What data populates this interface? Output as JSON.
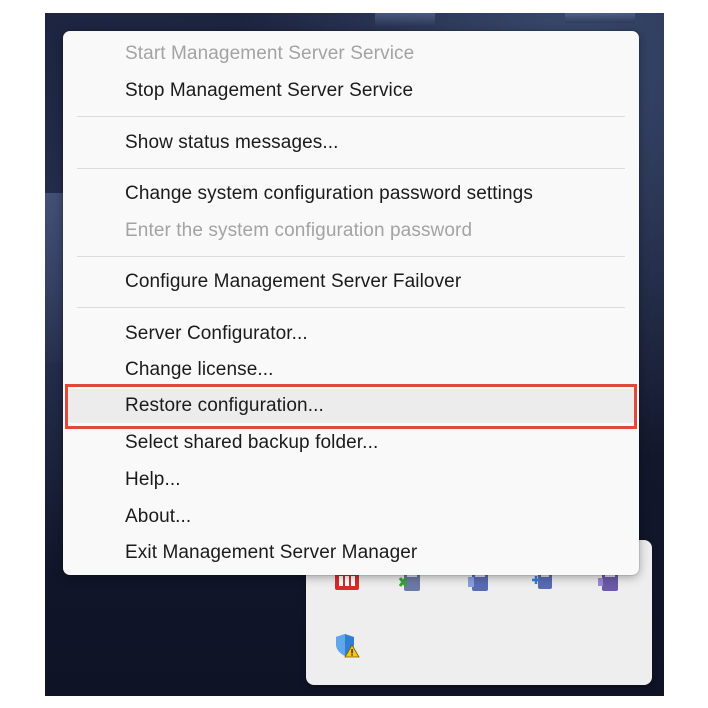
{
  "menu": {
    "items": [
      {
        "label": "Start Management Server Service",
        "enabled": false
      },
      {
        "label": "Stop Management Server Service",
        "enabled": true
      },
      {
        "label": "Show status messages...",
        "enabled": true
      },
      {
        "label": "Change system configuration password settings",
        "enabled": true
      },
      {
        "label": "Enter the system configuration password",
        "enabled": false
      },
      {
        "label": "Configure Management Server Failover",
        "enabled": true
      },
      {
        "label": "Server Configurator...",
        "enabled": true
      },
      {
        "label": "Change license...",
        "enabled": true
      },
      {
        "label": "Restore configuration...",
        "enabled": true,
        "highlighted": true
      },
      {
        "label": "Select shared backup folder...",
        "enabled": true
      },
      {
        "label": "Help...",
        "enabled": true
      },
      {
        "label": "About...",
        "enabled": true
      },
      {
        "label": "Exit Management Server Manager",
        "enabled": true
      }
    ]
  },
  "tray": {
    "icons": [
      "red-server-icon",
      "green-server-icon",
      "blue-server-icon",
      "blue-network-server-icon",
      "purple-server-icon",
      "security-shield-warning-icon"
    ]
  },
  "colors": {
    "highlight_border": "#e2493c",
    "disabled_text": "#a3a3a3",
    "menu_background": "#f9f9f9"
  }
}
